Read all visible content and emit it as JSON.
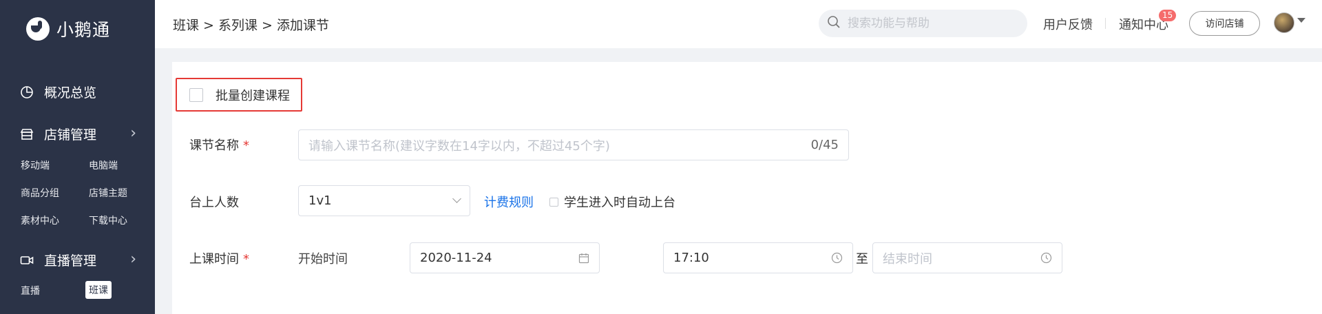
{
  "sidebar": {
    "logo_text": "小鹅通",
    "nav": {
      "overview": "概况总览",
      "store_mgmt": "店铺管理",
      "live_mgmt": "直播管理"
    },
    "store_sub": [
      "移动端",
      "电脑端",
      "商品分组",
      "店铺主题",
      "素材中心",
      "下载中心"
    ],
    "live_sub": [
      "直播",
      "班课"
    ],
    "active_sub": "班课"
  },
  "header": {
    "breadcrumb": "班课 > 系列课 > 添加课节",
    "search_placeholder": "搜索功能与帮助",
    "feedback": "用户反馈",
    "notify": "通知中心",
    "notify_count": "15",
    "visit_store": "访问店铺"
  },
  "form": {
    "batch_create": "批量创建课程",
    "title_label": "课节名称",
    "required_mark": "*",
    "title_placeholder": "请输入课节名称(建议字数在14字以内，不超过45个字)",
    "title_counter": "0/45",
    "stage_label": "台上人数",
    "stage_value": "1v1",
    "billing_rule": "计费规则",
    "auto_stage": "学生进入时自动上台",
    "time_label": "上课时间",
    "start_time_label": "开始时间",
    "date_value": "2020-11-24",
    "time_value": "17:10",
    "to": "至",
    "end_time_placeholder": "结束时间"
  },
  "colors": {
    "sidebar_bg": "#2b3347",
    "accent_link": "#1a73e8",
    "required": "#e53935",
    "badge": "#f56c6c"
  }
}
